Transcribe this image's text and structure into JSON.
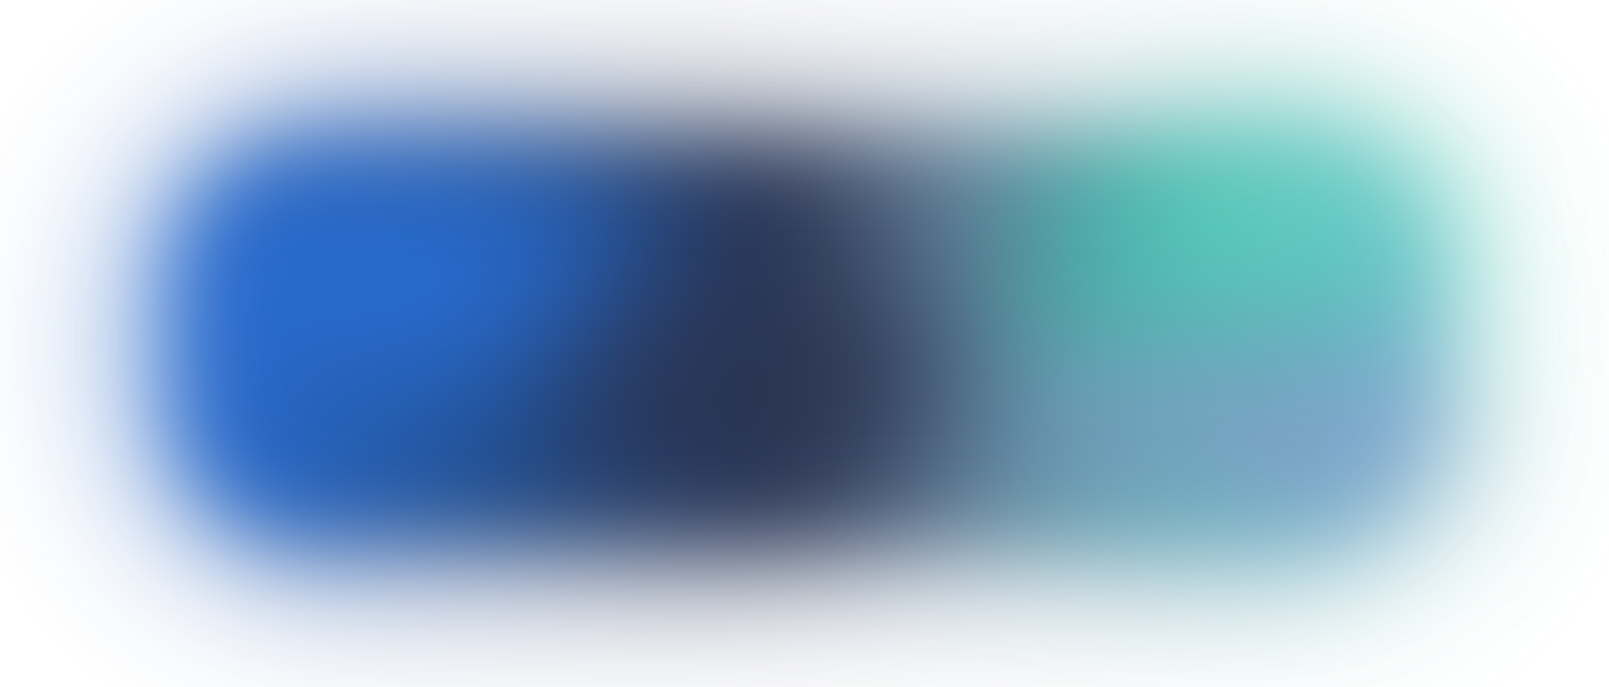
{
  "colors": {
    "background": "#ffffff",
    "blue": "#2a6fd6",
    "deep_blue": "#214a86",
    "navy": "#2a3452",
    "slate": "#5f7894",
    "teal": "#46b7ad",
    "mint": "#68d8c4",
    "lavender": "#8e98c8",
    "sky": "#7fb8de"
  }
}
